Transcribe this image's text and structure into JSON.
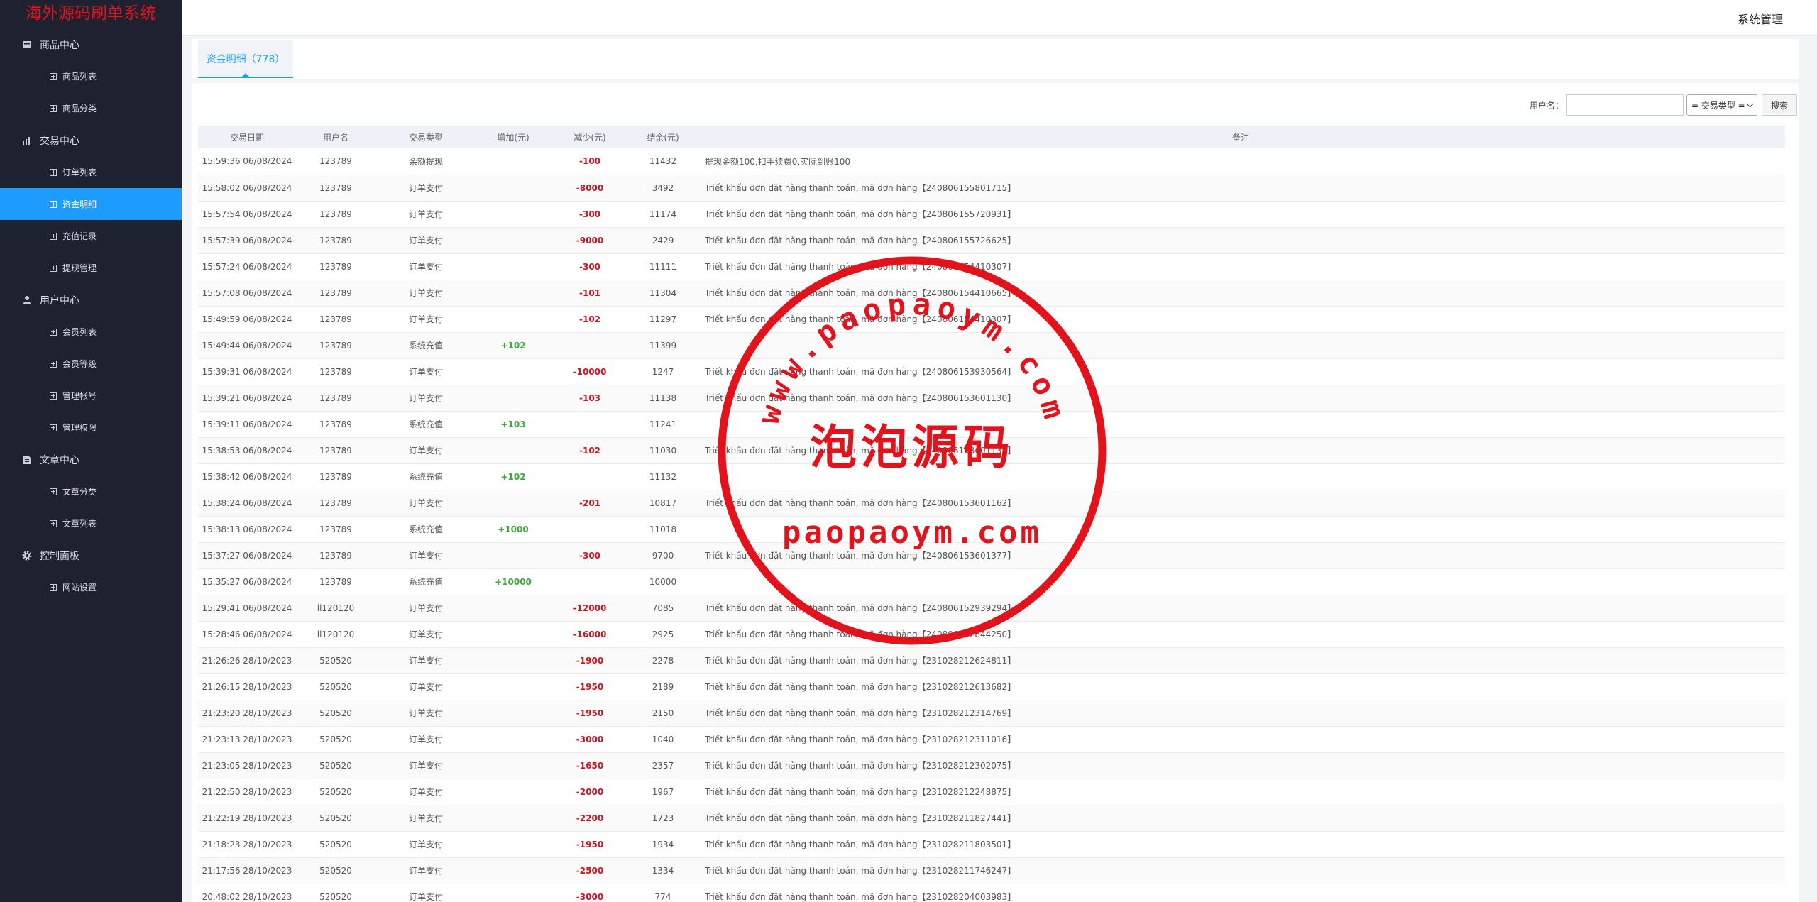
{
  "sidebar": {
    "brand": "海外源码刷单系统",
    "groups": [
      {
        "label": "商品中心",
        "icon": "box-icon",
        "items": [
          "商品列表",
          "商品分类"
        ]
      },
      {
        "label": "交易中心",
        "icon": "bar-chart-icon",
        "items": [
          "订单列表",
          "资金明细",
          "充值记录",
          "提现管理"
        ]
      },
      {
        "label": "用户中心",
        "icon": "user-icon",
        "items": [
          "会员列表",
          "会员等级",
          "管理帐号",
          "管理权限"
        ]
      },
      {
        "label": "文章中心",
        "icon": "document-icon",
        "items": [
          "文章分类",
          "文章列表"
        ]
      },
      {
        "label": "控制面板",
        "icon": "gear-icon",
        "items": [
          "网站设置"
        ]
      }
    ],
    "active_item": "资金明细"
  },
  "topbar": {
    "system_label": "系统管理"
  },
  "tab": {
    "label": "资金明细（778）"
  },
  "filters": {
    "username_label": "用户名：",
    "username_value": "",
    "type_select": "= 交易类型 =",
    "search_button": "搜索"
  },
  "table": {
    "headers": [
      "交易日期",
      "用户名",
      "交易类型",
      "增加(元)",
      "减少(元)",
      "结余(元)",
      "备注"
    ],
    "rows": [
      [
        "15:59:36 06/08/2024",
        "123789",
        "余额提现",
        "",
        "-100",
        "11432",
        "提现金额100,扣手续费0,实际到账100"
      ],
      [
        "15:58:02 06/08/2024",
        "123789",
        "订单支付",
        "",
        "-8000",
        "3492",
        "Triết khấu đơn đặt hàng thanh toán, mã đơn hàng【240806155801715】"
      ],
      [
        "15:57:54 06/08/2024",
        "123789",
        "订单支付",
        "",
        "-300",
        "11174",
        "Triết khấu đơn đặt hàng thanh toán, mã đơn hàng【240806155720931】"
      ],
      [
        "15:57:39 06/08/2024",
        "123789",
        "订单支付",
        "",
        "-9000",
        "2429",
        "Triết khấu đơn đặt hàng thanh toán, mã đơn hàng【240806155726625】"
      ],
      [
        "15:57:24 06/08/2024",
        "123789",
        "订单支付",
        "",
        "-300",
        "11111",
        "Triết khấu đơn đặt hàng thanh toán, mã đơn hàng【240806154410307】"
      ],
      [
        "15:57:08 06/08/2024",
        "123789",
        "订单支付",
        "",
        "-101",
        "11304",
        "Triết khấu đơn đặt hàng thanh toán, mã đơn hàng【240806154410665】"
      ],
      [
        "15:49:59 06/08/2024",
        "123789",
        "订单支付",
        "",
        "-102",
        "11297",
        "Triết khấu đơn đặt hàng thanh toán, mã đơn hàng【240806154410307】"
      ],
      [
        "15:49:44 06/08/2024",
        "123789",
        "系统充值",
        "+102",
        "",
        "11399",
        ""
      ],
      [
        "15:39:31 06/08/2024",
        "123789",
        "订单支付",
        "",
        "-10000",
        "1247",
        "Triết khấu đơn đặt hàng thanh toán, mã đơn hàng【240806153930564】"
      ],
      [
        "15:39:21 06/08/2024",
        "123789",
        "订单支付",
        "",
        "-103",
        "11138",
        "Triết khấu đơn đặt hàng thanh toán, mã đơn hàng【240806153601130】"
      ],
      [
        "15:39:11 06/08/2024",
        "123789",
        "系统充值",
        "+103",
        "",
        "11241",
        ""
      ],
      [
        "15:38:53 06/08/2024",
        "123789",
        "订单支付",
        "",
        "-102",
        "11030",
        "Triết khấu đơn đặt hàng thanh toán, mã đơn hàng【240806153601136】"
      ],
      [
        "15:38:42 06/08/2024",
        "123789",
        "系统充值",
        "+102",
        "",
        "11132",
        ""
      ],
      [
        "15:38:24 06/08/2024",
        "123789",
        "订单支付",
        "",
        "-201",
        "10817",
        "Triết khấu đơn đặt hàng thanh toán, mã đơn hàng【240806153601162】"
      ],
      [
        "15:38:13 06/08/2024",
        "123789",
        "系统充值",
        "+1000",
        "",
        "11018",
        ""
      ],
      [
        "15:37:27 06/08/2024",
        "123789",
        "订单支付",
        "",
        "-300",
        "9700",
        "Triết khấu đơn đặt hàng thanh toán, mã đơn hàng【240806153601377】"
      ],
      [
        "15:35:27 06/08/2024",
        "123789",
        "系统充值",
        "+10000",
        "",
        "10000",
        ""
      ],
      [
        "15:29:41 06/08/2024",
        "ll120120",
        "订单支付",
        "",
        "-12000",
        "7085",
        "Triết khấu đơn đặt hàng thanh toán, mã đơn hàng【240806152939294】"
      ],
      [
        "15:28:46 06/08/2024",
        "ll120120",
        "订单支付",
        "",
        "-16000",
        "2925",
        "Triết khấu đơn đặt hàng thanh toán, mã đơn hàng【240806152844250】"
      ],
      [
        "21:26:26 28/10/2023",
        "520520",
        "订单支付",
        "",
        "-1900",
        "2278",
        "Triết khấu đơn đặt hàng thanh toán, mã đơn hàng【231028212624811】"
      ],
      [
        "21:26:15 28/10/2023",
        "520520",
        "订单支付",
        "",
        "-1950",
        "2189",
        "Triết khấu đơn đặt hàng thanh toán, mã đơn hàng【231028212613682】"
      ],
      [
        "21:23:20 28/10/2023",
        "520520",
        "订单支付",
        "",
        "-1950",
        "2150",
        "Triết khấu đơn đặt hàng thanh toán, mã đơn hàng【231028212314769】"
      ],
      [
        "21:23:13 28/10/2023",
        "520520",
        "订单支付",
        "",
        "-3000",
        "1040",
        "Triết khấu đơn đặt hàng thanh toán, mã đơn hàng【231028212311016】"
      ],
      [
        "21:23:05 28/10/2023",
        "520520",
        "订单支付",
        "",
        "-1650",
        "2357",
        "Triết khấu đơn đặt hàng thanh toán, mã đơn hàng【231028212302075】"
      ],
      [
        "21:22:50 28/10/2023",
        "520520",
        "订单支付",
        "",
        "-2000",
        "1967",
        "Triết khấu đơn đặt hàng thanh toán, mã đơn hàng【231028212248875】"
      ],
      [
        "21:22:19 28/10/2023",
        "520520",
        "订单支付",
        "",
        "-2200",
        "1723",
        "Triết khấu đơn đặt hàng thanh toán, mã đơn hàng【231028211827441】"
      ],
      [
        "21:18:23 28/10/2023",
        "520520",
        "订单支付",
        "",
        "-1950",
        "1934",
        "Triết khấu đơn đặt hàng thanh toán, mã đơn hàng【231028211803501】"
      ],
      [
        "21:17:56 28/10/2023",
        "520520",
        "订单支付",
        "",
        "-2500",
        "1334",
        "Triết khấu đơn đặt hàng thanh toán, mã đơn hàng【231028211746247】"
      ],
      [
        "20:48:02 28/10/2023",
        "520520",
        "订单支付",
        "",
        "-3000",
        "774",
        "Triết khấu đơn đặt hàng thanh toán, mã đơn hàng【231028204003983】"
      ]
    ]
  },
  "watermark": {
    "ring_text": "www.paopaoym.com",
    "center_text": "泡泡源码",
    "bottom_text": "paopaoym.com",
    "color": "#e3121b"
  },
  "colors": {
    "accent": "#1e9bff",
    "sidebar_bg": "#1e2130",
    "increase": "#3eaa3c",
    "decrease": "#c91524"
  }
}
